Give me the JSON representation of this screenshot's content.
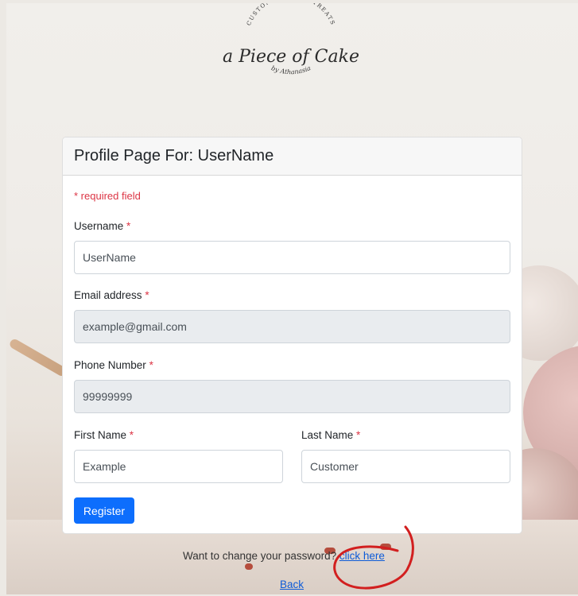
{
  "logo": {
    "top_arc_text": "CUSTOM CAKES & TREATS",
    "script_name": "a Piece of Cake",
    "bottom_arc_text": "by Athanasia"
  },
  "card": {
    "title": "Profile Page For: UserName",
    "required_note": "* required field",
    "fields": {
      "username": {
        "label": "Username",
        "value": "UserName"
      },
      "email": {
        "label": "Email address",
        "value": "example@gmail.com"
      },
      "phone": {
        "label": "Phone Number",
        "value": "99999999"
      },
      "first_name": {
        "label": "First Name",
        "value": "Example"
      },
      "last_name": {
        "label": "Last Name",
        "value": "Customer"
      }
    },
    "required_marker": "*",
    "submit_label": "Register"
  },
  "footer": {
    "change_password_prefix": "Want to change your password?",
    "change_password_link": "click here",
    "back_link": "Back"
  },
  "colors": {
    "primary": "#0d6efd",
    "required": "#dc3545",
    "annotation": "#d21f1f"
  }
}
